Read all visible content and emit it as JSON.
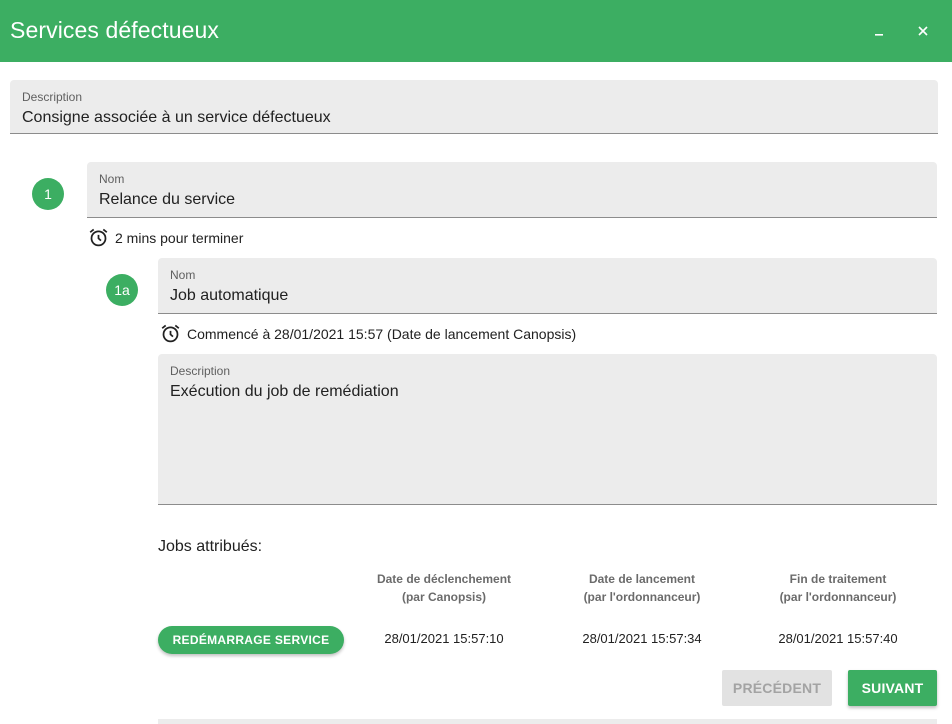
{
  "window": {
    "title": "Services défectueux",
    "minimize_icon": "minimize-icon",
    "close_icon": "close-icon",
    "accent_color": "#3cae62"
  },
  "instruction": {
    "description_label": "Description",
    "description_value": "Consigne associée à un service défectueux"
  },
  "operation": {
    "badge": "1",
    "name_label": "Nom",
    "name_value": "Relance du service",
    "duration_icon": "alarm-clock-icon",
    "duration_text": "2 mins pour terminer"
  },
  "substep": {
    "badge": "1a",
    "name_label": "Nom",
    "name_value": "Job automatique",
    "started_icon": "alarm-clock-icon",
    "started_text": "Commencé à 28/01/2021 15:57 (Date de lancement Canopsis)",
    "description_label": "Description",
    "description_value": "Exécution du job de remédiation"
  },
  "jobs": {
    "title": "Jobs attribués:",
    "columns": [
      {
        "line1": "Date de déclenchement",
        "line2": "(par Canopsis)"
      },
      {
        "line1": "Date de lancement",
        "line2": "(par l'ordonnanceur)"
      },
      {
        "line1": "Fin de traitement",
        "line2": "(par l'ordonnanceur)"
      }
    ],
    "rows": [
      {
        "job_label": "REDÉMARRAGE SERVICE",
        "triggered": "28/01/2021 15:57:10",
        "launched": "28/01/2021 15:57:34",
        "finished": "28/01/2021 15:57:40"
      }
    ]
  },
  "navigation": {
    "previous_label": "PRÉCÉDENT",
    "next_label": "SUIVANT"
  }
}
